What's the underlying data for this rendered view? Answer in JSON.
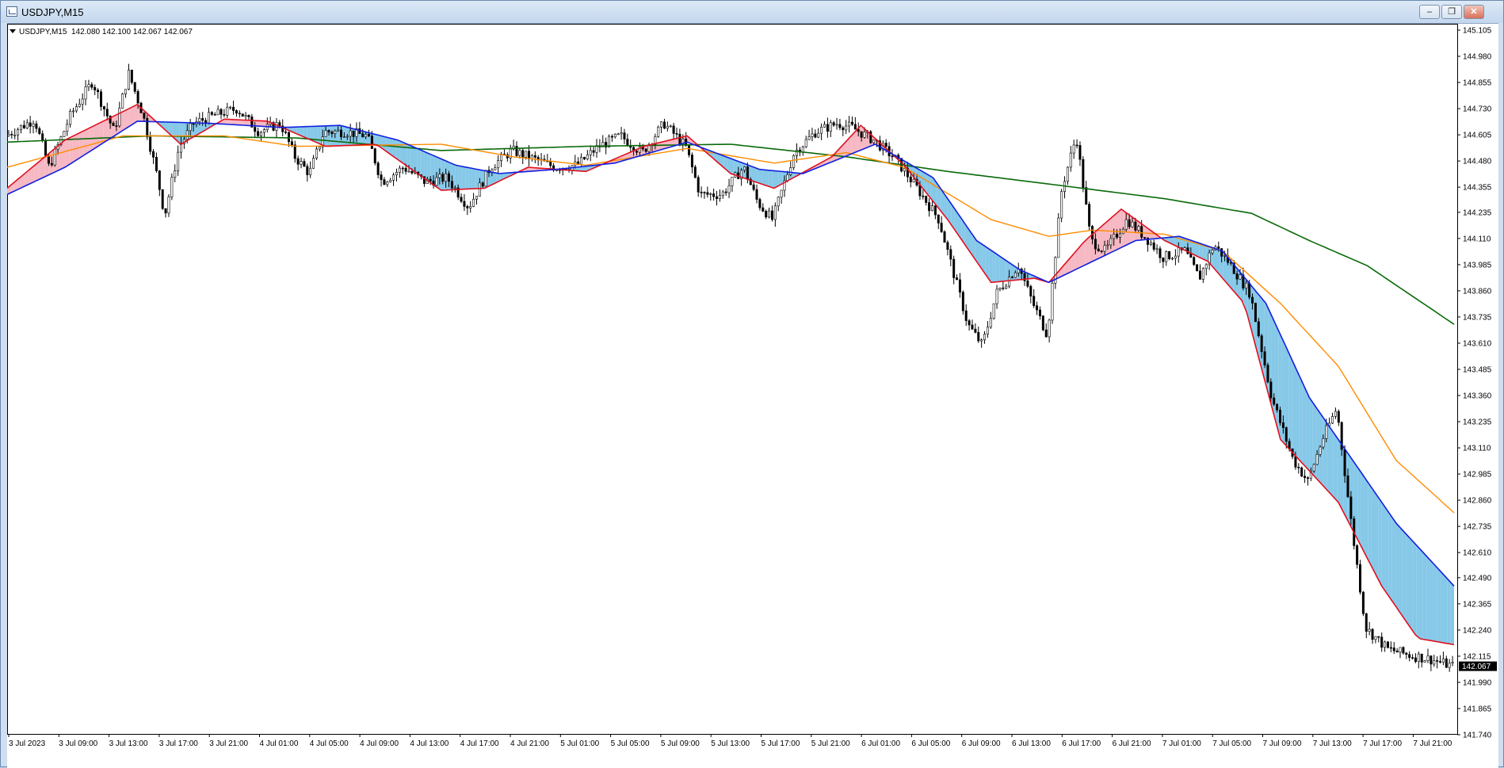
{
  "window": {
    "title": "USDJPY,M15",
    "buttons": {
      "minimize": "–",
      "restore": "❐",
      "close": "✕"
    }
  },
  "chart_header": {
    "symbol_tf": "USDJPY,M15",
    "ohlc": "142.080 142.100 142.067 142.067"
  },
  "colors": {
    "ribbon_up_fill": "#f6b8c3",
    "ribbon_down_fill": "#86c8e8",
    "fast_line": "#e01020",
    "slow_line": "#1020e0",
    "mid_ma": "#ff8c00",
    "long_ma": "#0a6a0a",
    "candle": "#000000",
    "current_price_bg": "#000000"
  },
  "chart_data": {
    "type": "candlestick",
    "symbol": "USDJPY",
    "timeframe": "M15",
    "y_axis": {
      "min": 141.74,
      "max": 145.105
    },
    "y_ticks": [
      "145.105",
      "144.980",
      "144.855",
      "144.730",
      "144.605",
      "144.480",
      "144.355",
      "144.235",
      "144.110",
      "143.985",
      "143.860",
      "143.735",
      "143.610",
      "143.485",
      "143.360",
      "143.235",
      "143.110",
      "142.985",
      "142.860",
      "142.735",
      "142.610",
      "142.490",
      "142.365",
      "142.240",
      "142.115",
      "141.990",
      "141.865",
      "141.740"
    ],
    "x_ticks": [
      "3 Jul 2023",
      "3 Jul 09:00",
      "3 Jul 13:00",
      "3 Jul 17:00",
      "3 Jul 21:00",
      "4 Jul 01:00",
      "4 Jul 05:00",
      "4 Jul 09:00",
      "4 Jul 13:00",
      "4 Jul 17:00",
      "4 Jul 21:00",
      "5 Jul 01:00",
      "5 Jul 05:00",
      "5 Jul 09:00",
      "5 Jul 13:00",
      "5 Jul 17:00",
      "5 Jul 21:00",
      "6 Jul 01:00",
      "6 Jul 05:00",
      "6 Jul 09:00",
      "6 Jul 13:00",
      "6 Jul 17:00",
      "6 Jul 21:00",
      "7 Jul 01:00",
      "7 Jul 05:00",
      "7 Jul 09:00",
      "7 Jul 13:00",
      "7 Jul 17:00",
      "7 Jul 21:00"
    ],
    "current_price": "142.067",
    "price_path": [
      [
        0,
        144.6
      ],
      [
        0.02,
        144.68
      ],
      [
        0.03,
        144.45
      ],
      [
        0.045,
        144.7
      ],
      [
        0.06,
        144.86
      ],
      [
        0.075,
        144.62
      ],
      [
        0.085,
        144.9
      ],
      [
        0.095,
        144.7
      ],
      [
        0.105,
        144.4
      ],
      [
        0.11,
        144.22
      ],
      [
        0.12,
        144.55
      ],
      [
        0.13,
        144.66
      ],
      [
        0.145,
        144.7
      ],
      [
        0.16,
        144.73
      ],
      [
        0.175,
        144.62
      ],
      [
        0.19,
        144.66
      ],
      [
        0.2,
        144.5
      ],
      [
        0.21,
        144.42
      ],
      [
        0.22,
        144.62
      ],
      [
        0.235,
        144.62
      ],
      [
        0.25,
        144.6
      ],
      [
        0.26,
        144.38
      ],
      [
        0.275,
        144.45
      ],
      [
        0.29,
        144.38
      ],
      [
        0.305,
        144.4
      ],
      [
        0.32,
        144.26
      ],
      [
        0.335,
        144.45
      ],
      [
        0.35,
        144.53
      ],
      [
        0.365,
        144.49
      ],
      [
        0.38,
        144.45
      ],
      [
        0.395,
        144.46
      ],
      [
        0.41,
        144.55
      ],
      [
        0.425,
        144.6
      ],
      [
        0.44,
        144.52
      ],
      [
        0.455,
        144.66
      ],
      [
        0.47,
        144.55
      ],
      [
        0.48,
        144.32
      ],
      [
        0.495,
        144.32
      ],
      [
        0.51,
        144.45
      ],
      [
        0.52,
        144.28
      ],
      [
        0.53,
        144.2
      ],
      [
        0.545,
        144.52
      ],
      [
        0.56,
        144.62
      ],
      [
        0.575,
        144.66
      ],
      [
        0.585,
        144.64
      ],
      [
        0.6,
        144.58
      ],
      [
        0.615,
        144.49
      ],
      [
        0.63,
        144.35
      ],
      [
        0.645,
        144.2
      ],
      [
        0.655,
        143.95
      ],
      [
        0.665,
        143.7
      ],
      [
        0.675,
        143.6
      ],
      [
        0.685,
        143.85
      ],
      [
        0.7,
        143.98
      ],
      [
        0.71,
        143.8
      ],
      [
        0.72,
        143.65
      ],
      [
        0.73,
        144.35
      ],
      [
        0.74,
        144.6
      ],
      [
        0.75,
        144.1
      ],
      [
        0.76,
        144.05
      ],
      [
        0.775,
        144.2
      ],
      [
        0.79,
        144.1
      ],
      [
        0.8,
        144.02
      ],
      [
        0.815,
        144.05
      ],
      [
        0.825,
        143.92
      ],
      [
        0.835,
        144.08
      ],
      [
        0.845,
        144.0
      ],
      [
        0.86,
        143.85
      ],
      [
        0.875,
        143.35
      ],
      [
        0.89,
        143.05
      ],
      [
        0.9,
        142.95
      ],
      [
        0.91,
        143.15
      ],
      [
        0.92,
        143.3
      ],
      [
        0.93,
        142.75
      ],
      [
        0.94,
        142.25
      ],
      [
        0.955,
        142.15
      ],
      [
        0.97,
        142.12
      ],
      [
        0.985,
        142.1
      ],
      [
        1.0,
        142.067
      ]
    ],
    "long_ma": [
      [
        0,
        144.57
      ],
      [
        0.1,
        144.6
      ],
      [
        0.2,
        144.59
      ],
      [
        0.3,
        144.53
      ],
      [
        0.4,
        144.55
      ],
      [
        0.5,
        144.56
      ],
      [
        0.58,
        144.5
      ],
      [
        0.65,
        144.43
      ],
      [
        0.72,
        144.37
      ],
      [
        0.8,
        144.3
      ],
      [
        0.86,
        144.23
      ],
      [
        0.9,
        144.1
      ],
      [
        0.94,
        143.98
      ],
      [
        1.0,
        143.7
      ]
    ],
    "mid_ma": [
      [
        0,
        144.45
      ],
      [
        0.08,
        144.6
      ],
      [
        0.15,
        144.6
      ],
      [
        0.2,
        144.55
      ],
      [
        0.3,
        144.56
      ],
      [
        0.35,
        144.5
      ],
      [
        0.4,
        144.46
      ],
      [
        0.47,
        144.54
      ],
      [
        0.53,
        144.47
      ],
      [
        0.58,
        144.52
      ],
      [
        0.62,
        144.45
      ],
      [
        0.68,
        144.2
      ],
      [
        0.72,
        144.12
      ],
      [
        0.75,
        144.15
      ],
      [
        0.8,
        144.13
      ],
      [
        0.84,
        144.05
      ],
      [
        0.88,
        143.8
      ],
      [
        0.92,
        143.5
      ],
      [
        0.96,
        143.05
      ],
      [
        1.0,
        142.8
      ]
    ],
    "fast_line": [
      [
        0,
        144.35
      ],
      [
        0.04,
        144.58
      ],
      [
        0.09,
        144.75
      ],
      [
        0.12,
        144.56
      ],
      [
        0.15,
        144.68
      ],
      [
        0.18,
        144.67
      ],
      [
        0.22,
        144.55
      ],
      [
        0.255,
        144.56
      ],
      [
        0.3,
        144.34
      ],
      [
        0.33,
        144.35
      ],
      [
        0.36,
        144.45
      ],
      [
        0.4,
        144.43
      ],
      [
        0.44,
        144.55
      ],
      [
        0.47,
        144.6
      ],
      [
        0.5,
        144.42
      ],
      [
        0.53,
        144.35
      ],
      [
        0.57,
        144.5
      ],
      [
        0.59,
        144.65
      ],
      [
        0.62,
        144.46
      ],
      [
        0.65,
        144.2
      ],
      [
        0.68,
        143.9
      ],
      [
        0.71,
        143.92
      ],
      [
        0.72,
        143.9
      ],
      [
        0.745,
        144.1
      ],
      [
        0.77,
        144.25
      ],
      [
        0.8,
        144.1
      ],
      [
        0.83,
        144.0
      ],
      [
        0.855,
        143.8
      ],
      [
        0.88,
        143.15
      ],
      [
        0.92,
        142.85
      ],
      [
        0.95,
        142.45
      ],
      [
        0.975,
        142.2
      ],
      [
        1.0,
        142.17
      ]
    ],
    "slow_line": [
      [
        0,
        144.32
      ],
      [
        0.04,
        144.45
      ],
      [
        0.09,
        144.67
      ],
      [
        0.14,
        144.66
      ],
      [
        0.19,
        144.64
      ],
      [
        0.23,
        144.65
      ],
      [
        0.27,
        144.58
      ],
      [
        0.31,
        144.46
      ],
      [
        0.34,
        144.42
      ],
      [
        0.38,
        144.44
      ],
      [
        0.42,
        144.47
      ],
      [
        0.47,
        144.57
      ],
      [
        0.52,
        144.44
      ],
      [
        0.55,
        144.42
      ],
      [
        0.6,
        144.56
      ],
      [
        0.64,
        144.4
      ],
      [
        0.67,
        144.1
      ],
      [
        0.7,
        143.96
      ],
      [
        0.72,
        143.9
      ],
      [
        0.75,
        144.0
      ],
      [
        0.78,
        144.1
      ],
      [
        0.81,
        144.12
      ],
      [
        0.84,
        144.05
      ],
      [
        0.87,
        143.8
      ],
      [
        0.9,
        143.35
      ],
      [
        0.93,
        143.05
      ],
      [
        0.96,
        142.75
      ],
      [
        1.0,
        142.45
      ]
    ]
  }
}
